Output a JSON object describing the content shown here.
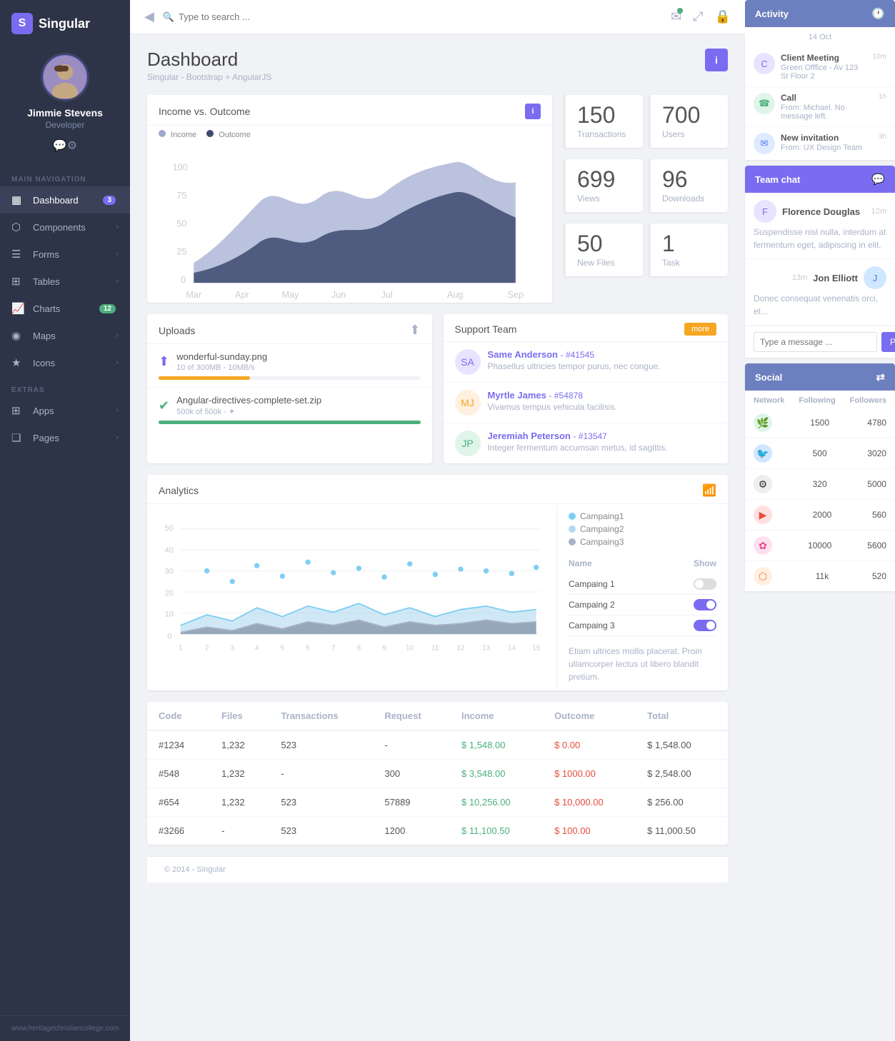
{
  "app": {
    "name": "Singular",
    "logo_symbol": "S"
  },
  "sidebar": {
    "user": {
      "name": "Jimmie Stevens",
      "role": "Developer"
    },
    "main_nav_label": "MAIN NAVIGATION",
    "extras_label": "EXTRAS",
    "items": [
      {
        "id": "dashboard",
        "label": "Dashboard",
        "icon": "▦",
        "active": true,
        "badge": "3",
        "badge_color": "purple",
        "arrow": false
      },
      {
        "id": "components",
        "label": "Components",
        "icon": "⬡",
        "active": false,
        "badge": null,
        "arrow": true
      },
      {
        "id": "forms",
        "label": "Forms",
        "icon": "☰",
        "active": false,
        "badge": null,
        "arrow": true
      },
      {
        "id": "tables",
        "label": "Tables",
        "icon": "⊞",
        "active": false,
        "badge": null,
        "arrow": true
      },
      {
        "id": "charts",
        "label": "Charts",
        "icon": "📈",
        "active": false,
        "badge": "12",
        "badge_color": "green",
        "arrow": true
      },
      {
        "id": "maps",
        "label": "Maps",
        "icon": "◉",
        "active": false,
        "badge": null,
        "arrow": true
      },
      {
        "id": "icons",
        "label": "Icons",
        "icon": "★",
        "active": false,
        "badge": null,
        "arrow": true
      }
    ],
    "extras_items": [
      {
        "id": "apps",
        "label": "Apps",
        "icon": "⊞",
        "active": false,
        "badge": null,
        "arrow": true
      },
      {
        "id": "pages",
        "label": "Pages",
        "icon": "❏",
        "active": false,
        "badge": null,
        "arrow": true
      }
    ],
    "footer": "www.heritagechristiancollege.com"
  },
  "topbar": {
    "search_placeholder": "Type to search ...",
    "collapse_icon": "◀"
  },
  "page": {
    "title": "Dashboard",
    "subtitle": "Singular - Bootstrap + AngularJS",
    "info_btn": "i"
  },
  "income_chart": {
    "title": "Income vs. Outcome",
    "info_btn": "i",
    "legend": [
      {
        "label": "Income",
        "color": "#9ea8d0"
      },
      {
        "label": "Outcome",
        "color": "#3d4a6e"
      }
    ],
    "y_labels": [
      "0",
      "25",
      "50",
      "75",
      "100"
    ],
    "x_labels": [
      "Mar",
      "Apr",
      "May",
      "Jun",
      "Jul",
      "Aug",
      "Sep"
    ]
  },
  "stats": [
    {
      "id": "transactions",
      "value": "150",
      "label": "Transactions"
    },
    {
      "id": "users",
      "value": "700",
      "label": "Users"
    },
    {
      "id": "views",
      "value": "699",
      "label": "Views"
    },
    {
      "id": "downloads",
      "value": "96",
      "label": "Downloads"
    },
    {
      "id": "new_files",
      "value": "50",
      "label": "New Files"
    },
    {
      "id": "task",
      "value": "1",
      "label": "Task"
    }
  ],
  "uploads": {
    "title": "Uploads",
    "items": [
      {
        "id": "upload1",
        "filename": "wonderful-sunday.png",
        "size": "10 of 300MB - 10MB/s",
        "progress": 35,
        "progress_color": "orange",
        "status_icon": "upload"
      },
      {
        "id": "upload2",
        "filename": "Angular-directives-complete-set.zip",
        "size": "500k of 500k - ✦",
        "progress": 100,
        "progress_color": "green",
        "status_icon": "check"
      }
    ]
  },
  "support_team": {
    "title": "Support Team",
    "more_btn": "more",
    "members": [
      {
        "id": "member1",
        "name": "Same Anderson",
        "ticket": "#41545",
        "text": "Phasellus ultricies tempor purus, nec congue.",
        "avatar_color": "purple"
      },
      {
        "id": "member2",
        "name": "Myrtle James",
        "ticket": "#54878",
        "text": "Vivamus tempus vehicula facilisis.",
        "avatar_color": "orange"
      },
      {
        "id": "member3",
        "name": "Jeremiah Peterson",
        "ticket": "#13547",
        "text": "Integer fermentum accumsan metus, id sagittis.",
        "avatar_color": "green"
      }
    ]
  },
  "analytics": {
    "title": "Analytics",
    "campaigns": [
      {
        "id": "c1",
        "label": "Campaing1",
        "color": "#7ecef4",
        "toggle": "off"
      },
      {
        "id": "c2",
        "label": "Campaing2",
        "color": "#b0d8f0",
        "toggle": "on"
      },
      {
        "id": "c3",
        "label": "Campaing3",
        "color": "#aab2c8",
        "toggle": "on"
      }
    ],
    "toggle_labels": [
      "Campaing 1",
      "Campaing 2",
      "Campaing 3"
    ],
    "toggle_states": [
      "off",
      "on",
      "on"
    ],
    "table_headers": [
      "Name",
      "Show"
    ],
    "description": "Etiam ultrices mollis placerat. Proin ullamcorper lectus ut libero blandit pretium.",
    "x_labels": [
      "1",
      "2",
      "3",
      "4",
      "5",
      "6",
      "7",
      "8",
      "9",
      "10",
      "11",
      "12",
      "13",
      "14",
      "15"
    ],
    "y_labels": [
      "0",
      "10",
      "20",
      "30",
      "40",
      "50"
    ]
  },
  "data_table": {
    "columns": [
      "Code",
      "Files",
      "Transactions",
      "Request",
      "Income",
      "Outcome",
      "Total"
    ],
    "rows": [
      {
        "code": "#1234",
        "files": "1,232",
        "transactions": "523",
        "request": "-",
        "income": "$ 1,548.00",
        "outcome": "$ 0.00",
        "total": "$ 1,548.00"
      },
      {
        "code": "#548",
        "files": "1,232",
        "transactions": "-",
        "request": "300",
        "income": "$ 3,548.00",
        "outcome": "$ 1000.00",
        "total": "$ 2,548.00"
      },
      {
        "code": "#654",
        "files": "1,232",
        "transactions": "523",
        "request": "57889",
        "income": "$ 10,256.00",
        "outcome": "$ 10,000.00",
        "total": "$ 256.00"
      },
      {
        "code": "#3266",
        "files": "-",
        "transactions": "523",
        "request": "1200",
        "income": "$ 11,100.50",
        "outcome": "$ 100.00",
        "total": "$ 11,000.50"
      }
    ]
  },
  "activity": {
    "panel_title": "Activity",
    "date_label": "14 Oct",
    "items": [
      {
        "id": "act1",
        "title": "Client Meeting",
        "detail": "Green Offfice - Av 123 St Floor 2",
        "time": "10m",
        "avatar_color": "purple",
        "avatar_icon": "C"
      },
      {
        "id": "act2",
        "title": "Call",
        "detail": "From: Michael. No message left.",
        "time": "1h",
        "avatar_color": "green",
        "avatar_icon": "☎"
      },
      {
        "id": "act3",
        "title": "New invitation",
        "detail": "From: UX Design Team",
        "time": "3h",
        "avatar_color": "blue",
        "avatar_icon": "✉"
      }
    ]
  },
  "team_chat": {
    "panel_title": "Team chat",
    "messages": [
      {
        "id": "msg1",
        "name": "Florence Douglas",
        "time": "12m",
        "text": "Suspendisse nisl nulla, interdum at fermentum eget, adipiscing in elit.",
        "avatar_color": "purple",
        "avatar_icon": "F"
      },
      {
        "id": "msg2",
        "name": "Jon Elliott",
        "time": "13m",
        "text": "Donec consequat venenatis orci, et...",
        "avatar_color": "blue",
        "avatar_icon": "J"
      }
    ],
    "input_placeholder": "Type a message ...",
    "send_btn": "Post"
  },
  "social": {
    "panel_title": "Social",
    "headers": [
      "Network",
      "Following",
      "Followers"
    ],
    "rows": [
      {
        "id": "soc1",
        "icon_type": "green",
        "icon": "🌿",
        "following": "1500",
        "followers": "4780"
      },
      {
        "id": "soc2",
        "icon_type": "blue",
        "icon": "🐦",
        "following": "500",
        "followers": "3020"
      },
      {
        "id": "soc3",
        "icon_type": "dark",
        "icon": "⚙",
        "following": "320",
        "followers": "5000"
      },
      {
        "id": "soc4",
        "icon_type": "red",
        "icon": "▶",
        "following": "2000",
        "followers": "560"
      },
      {
        "id": "soc5",
        "icon_type": "pink",
        "icon": "✿",
        "following": "10000",
        "followers": "5600"
      },
      {
        "id": "soc6",
        "icon_type": "orange",
        "icon": "⬡",
        "following": "11k",
        "followers": "520"
      }
    ]
  },
  "footer": "© 2014 - Singular"
}
